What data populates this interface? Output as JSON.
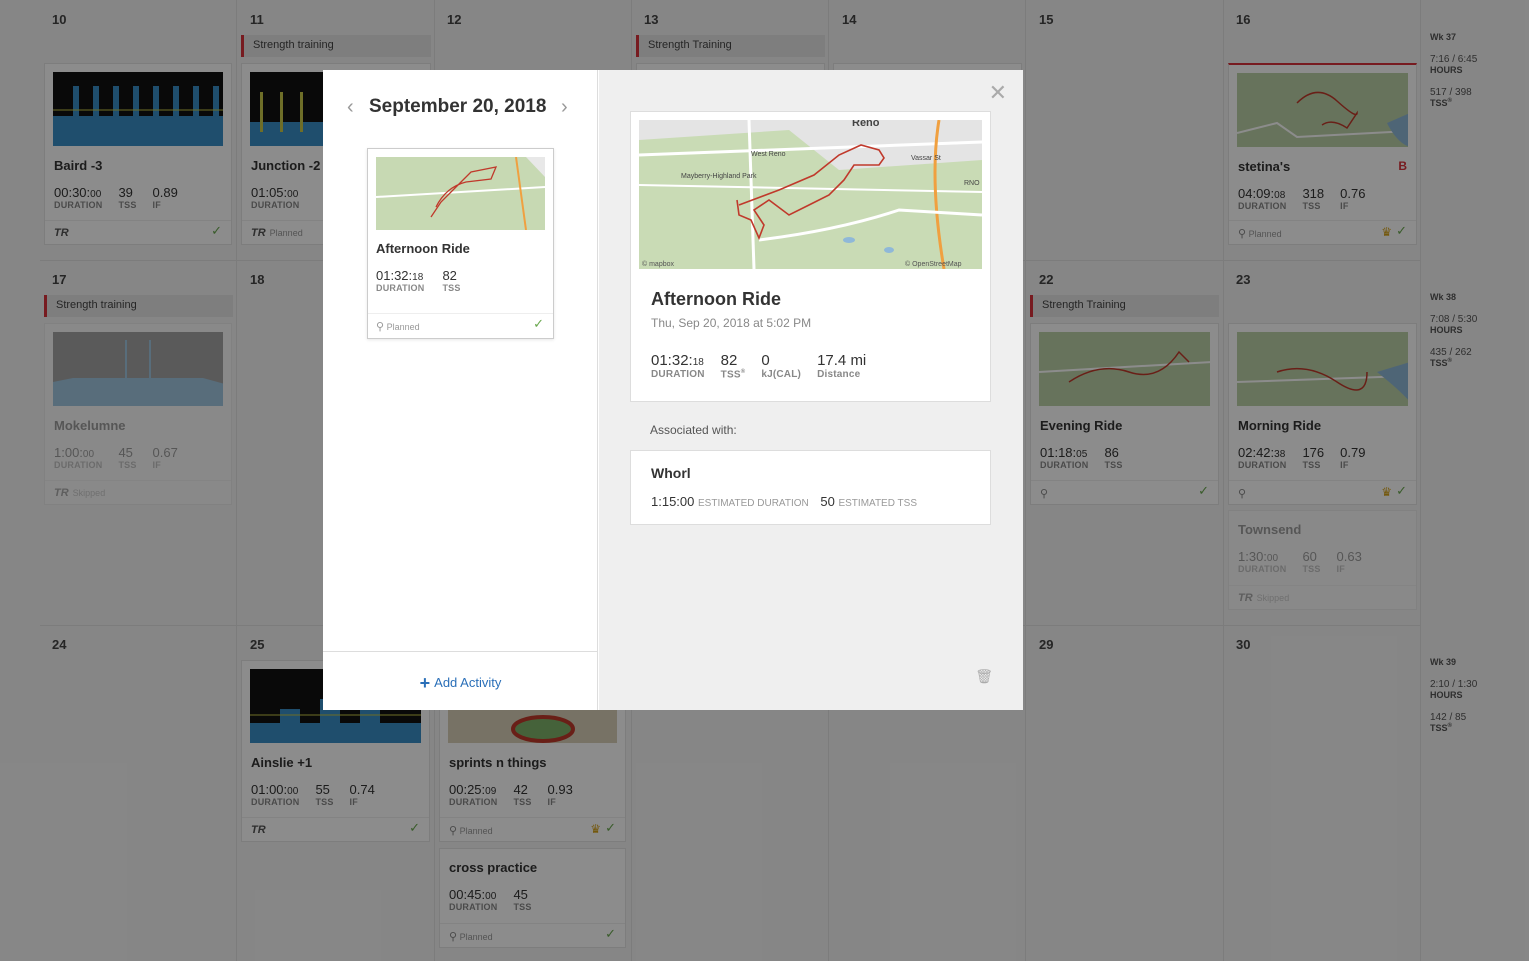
{
  "calendar": {
    "week1_days": [
      "10",
      "11",
      "12",
      "13",
      "14",
      "15",
      "16"
    ],
    "week2_days": [
      "17",
      "18",
      "22",
      "23"
    ],
    "week3_days": [
      "24",
      "25",
      "29",
      "30"
    ],
    "strength": {
      "s11": "Strength training",
      "s13": "Strength Training",
      "s17": "Strength training",
      "s22": "Strength Training"
    },
    "cards": {
      "baird": {
        "title": "Baird -3",
        "dur": "00:30:",
        "dur_s": "00",
        "tss": "39",
        "if": "0.89",
        "foot": "TR"
      },
      "junction": {
        "title": "Junction -2",
        "dur": "01:05:",
        "dur_s": "00",
        "foot": "TR",
        "foot_status": "Planned"
      },
      "stetina": {
        "title": "stetina's",
        "badge": "B",
        "dur": "04:09:",
        "dur_s": "08",
        "tss": "318",
        "if": "0.76",
        "foot_status": "Planned"
      },
      "mokelumne": {
        "title": "Mokelumne",
        "dur": "1:00:",
        "dur_s": "00",
        "tss": "45",
        "if": "0.67",
        "foot": "TR",
        "foot_status": "Skipped"
      },
      "evening": {
        "title": "Evening Ride",
        "dur": "01:18:",
        "dur_s": "05",
        "tss": "86"
      },
      "morning": {
        "title": "Morning Ride",
        "dur": "02:42:",
        "dur_s": "38",
        "tss": "176",
        "if": "0.79"
      },
      "townsend": {
        "title": "Townsend",
        "dur": "1:30:",
        "dur_s": "00",
        "tss": "60",
        "if": "0.63",
        "foot": "TR",
        "foot_status": "Skipped"
      },
      "ainslie": {
        "title": "Ainslie +1",
        "dur": "01:00:",
        "dur_s": "00",
        "tss": "55",
        "if": "0.74",
        "foot": "TR"
      },
      "sprints": {
        "title": "sprints n things",
        "dur": "00:25:",
        "dur_s": "09",
        "tss": "42",
        "if": "0.93",
        "foot_status": "Planned"
      },
      "cross": {
        "title": "cross practice",
        "dur": "00:45:",
        "dur_s": "00",
        "tss": "45",
        "foot_status": "Planned"
      }
    },
    "labels": {
      "duration": "DURATION",
      "tss": "TSS",
      "if": "IF"
    },
    "weeks": [
      {
        "wk": "Wk 37",
        "hours": "7:16 / 6:45",
        "hours_lbl": "HOURS",
        "tss": "517 / 398",
        "tss_lbl": "TSS"
      },
      {
        "wk": "Wk 38",
        "hours": "7:08 / 5:30",
        "hours_lbl": "HOURS",
        "tss": "435 / 262",
        "tss_lbl": "TSS"
      },
      {
        "wk": "Wk 39",
        "hours": "2:10 / 1:30",
        "hours_lbl": "HOURS",
        "tss": "142 / 85",
        "tss_lbl": "TSS"
      }
    ]
  },
  "modal": {
    "date": "September 20, 2018",
    "mini": {
      "title": "Afternoon Ride",
      "dur": "01:32:",
      "dur_s": "18",
      "tss": "82",
      "dur_lbl": "DURATION",
      "tss_lbl": "TSS",
      "status": "Planned"
    },
    "add_activity": "Add Activity",
    "detail": {
      "title": "Afternoon Ride",
      "subtitle": "Thu, Sep 20, 2018 at 5:02 PM",
      "dur": "01:32:",
      "dur_s": "18",
      "dur_lbl": "DURATION",
      "tss": "82",
      "tss_lbl": "TSS",
      "kj": "0",
      "kj_lbl": "kJ(CAL)",
      "dist": "17.4 mi",
      "dist_lbl": "Distance",
      "map_labels": [
        "Reno",
        "West Reno",
        "Vassar St",
        "Mayberry-Highland Park",
        "RNO",
        "© mapbox",
        "© OpenStreetMap"
      ]
    },
    "assoc_label": "Associated with:",
    "assoc": {
      "name": "Whorl",
      "dur": "1:15:00",
      "dur_lbl": "ESTIMATED DURATION",
      "tss": "50",
      "tss_lbl": "ESTIMATED TSS"
    }
  }
}
